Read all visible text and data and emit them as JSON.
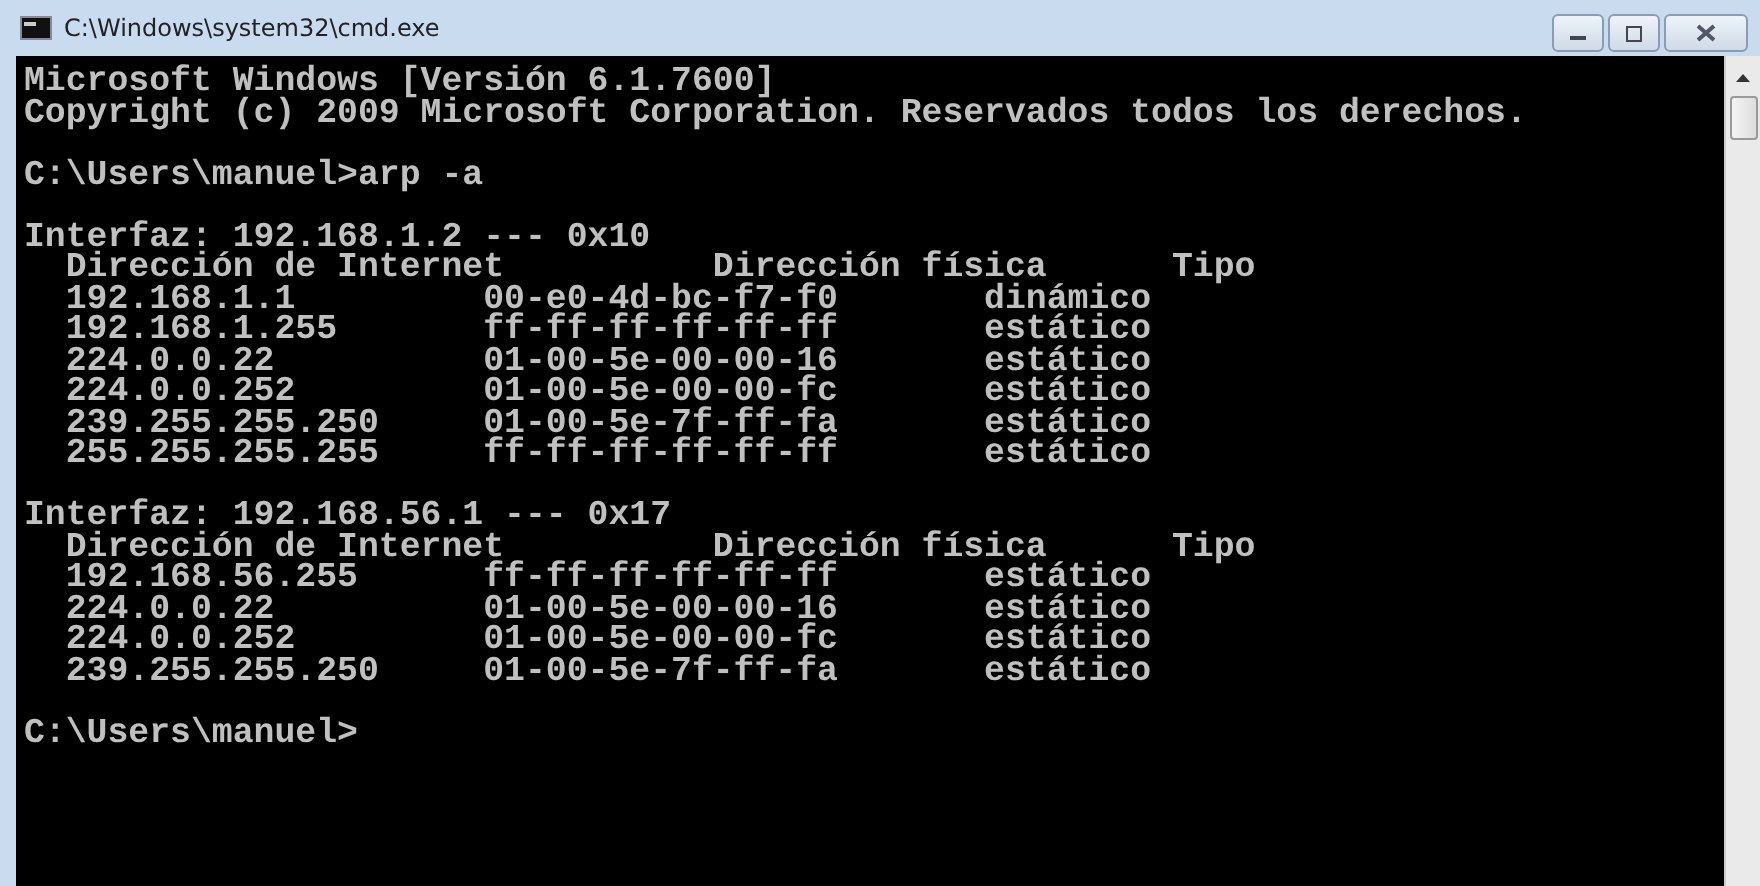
{
  "window": {
    "title": "C:\\Windows\\system32\\cmd.exe"
  },
  "console": {
    "banner": [
      "Microsoft Windows [Versión 6.1.7600]",
      "Copyright (c) 2009 Microsoft Corporation. Reservados todos los derechos."
    ],
    "command_line": "C:\\Users\\manuel>arp -a",
    "interfaces": [
      {
        "header": "Interfaz: 192.168.1.2 --- 0x10",
        "columns": [
          "Dirección de Internet",
          "Dirección física",
          "Tipo"
        ],
        "entries": [
          {
            "address": "192.168.1.1",
            "mac": "00-e0-4d-bc-f7-f0",
            "type": "dinámico"
          },
          {
            "address": "192.168.1.255",
            "mac": "ff-ff-ff-ff-ff-ff",
            "type": "estático"
          },
          {
            "address": "224.0.0.22",
            "mac": "01-00-5e-00-00-16",
            "type": "estático"
          },
          {
            "address": "224.0.0.252",
            "mac": "01-00-5e-00-00-fc",
            "type": "estático"
          },
          {
            "address": "239.255.255.250",
            "mac": "01-00-5e-7f-ff-fa",
            "type": "estático"
          },
          {
            "address": "255.255.255.255",
            "mac": "ff-ff-ff-ff-ff-ff",
            "type": "estático"
          }
        ]
      },
      {
        "header": "Interfaz: 192.168.56.1 --- 0x17",
        "columns": [
          "Dirección de Internet",
          "Dirección física",
          "Tipo"
        ],
        "entries": [
          {
            "address": "192.168.56.255",
            "mac": "ff-ff-ff-ff-ff-ff",
            "type": "estático"
          },
          {
            "address": "224.0.0.22",
            "mac": "01-00-5e-00-00-16",
            "type": "estático"
          },
          {
            "address": "224.0.0.252",
            "mac": "01-00-5e-00-00-fc",
            "type": "estático"
          },
          {
            "address": "239.255.255.250",
            "mac": "01-00-5e-7f-ff-fa",
            "type": "estático"
          }
        ]
      }
    ],
    "prompt": "C:\\Users\\manuel>"
  }
}
